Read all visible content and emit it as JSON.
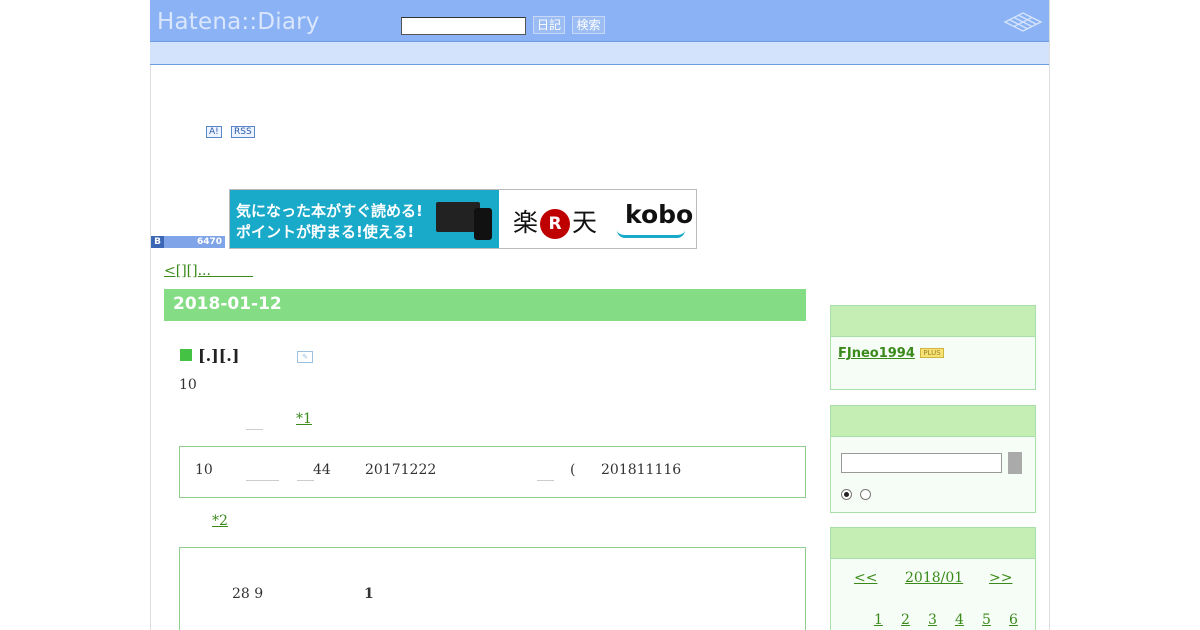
{
  "header": {
    "logo": "Hatena::Diary",
    "search_value": "",
    "diary_button": "日記",
    "search_button": "検索"
  },
  "toolbar_badges": [
    "A!",
    "RSS"
  ],
  "bookmark_counter": {
    "label": "B",
    "count": "6470"
  },
  "banner": {
    "line1": "気になった本がすぐ読める!",
    "line2": "ポイントが貯まる!使える!",
    "brand_left": "楽",
    "brand_r": "R",
    "brand_right": "天",
    "kobo": "kobo"
  },
  "nav": {
    "prev": "<[][]...　　　"
  },
  "entry": {
    "date": "2018-01-12",
    "title": "[.][.]",
    "p1": "10",
    "footnote1": "*1",
    "quote1": {
      "a": "10",
      "b": "44",
      "c": "20171222",
      "d": "(",
      "e": "201811116"
    },
    "footnote2": "*2",
    "quote2": {
      "a": "28 9",
      "b": "1"
    }
  },
  "sidebar": {
    "user": "FJneo1994",
    "plus_badge": "PLUS",
    "search_value": "",
    "calendar": {
      "prev": "<<",
      "month": "2018/01",
      "next": ">>",
      "days": [
        "1",
        "2",
        "3",
        "4",
        "5",
        "6"
      ]
    }
  },
  "colors": {
    "header_bg": "#8ab2f4",
    "date_bar": "#84dd84",
    "link": "#3a8a1b",
    "side_head": "#c4eeb4"
  }
}
